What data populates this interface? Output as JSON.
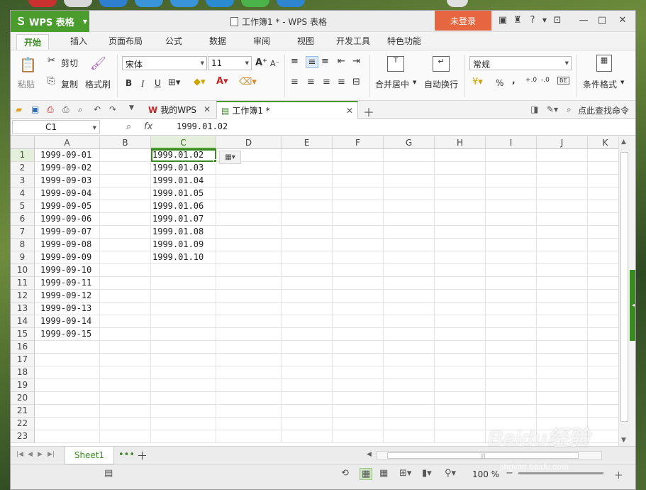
{
  "app": {
    "name": "WPS 表格",
    "doc_title": "工作簿1 * - WPS 表格",
    "login_label": "未登录"
  },
  "menu_tabs": [
    "开始",
    "插入",
    "页面布局",
    "公式",
    "数据",
    "审阅",
    "视图",
    "开发工具",
    "特色功能"
  ],
  "ribbon": {
    "paste": "粘贴",
    "cut": "剪切",
    "copy": "复制",
    "format_painter": "格式刷",
    "font_name": "宋体",
    "font_size": "11",
    "bold": "B",
    "italic": "I",
    "underline": "U",
    "merge_center": "合并居中",
    "wrap_text": "自动换行",
    "number_format": "常规",
    "percent": "%",
    "thousands": ",",
    "cond_format": "条件格式"
  },
  "doc_tabs": {
    "my_wps": "我的WPS",
    "workbook": "工作簿1 *",
    "search": "点此查找命令"
  },
  "formula_bar": {
    "name_box": "C1",
    "fx": "fx",
    "content": "1999.01.02"
  },
  "grid": {
    "columns": [
      "A",
      "B",
      "C",
      "D",
      "E",
      "F",
      "G",
      "H",
      "I",
      "J",
      "K"
    ],
    "rows": [
      "1",
      "2",
      "3",
      "4",
      "5",
      "6",
      "7",
      "8",
      "9",
      "10",
      "11",
      "12",
      "13",
      "14",
      "15",
      "16",
      "17",
      "18",
      "19",
      "20",
      "21",
      "22",
      "23"
    ],
    "colA": [
      "1999-09-01",
      "1999-09-02",
      "1999-09-03",
      "1999-09-04",
      "1999-09-05",
      "1999-09-06",
      "1999-09-07",
      "1999-09-08",
      "1999-09-09",
      "1999-09-10",
      "1999-09-11",
      "1999-09-12",
      "1999-09-13",
      "1999-09-14",
      "1999-09-15"
    ],
    "colC": [
      "1999.01.02",
      "1999.01.03",
      "1999.01.04",
      "1999.01.05",
      "1999.01.06",
      "1999.01.07",
      "1999.01.08",
      "1999.01.09",
      "1999.01.10"
    ]
  },
  "sheets": [
    "Sheet1"
  ],
  "status": {
    "zoom": "100 %"
  },
  "watermark": {
    "brand": "Baidu经验",
    "url": "jingyan.baidu.com"
  },
  "colors": {
    "accent": "#4a9d2d",
    "login": "#e5663f"
  }
}
